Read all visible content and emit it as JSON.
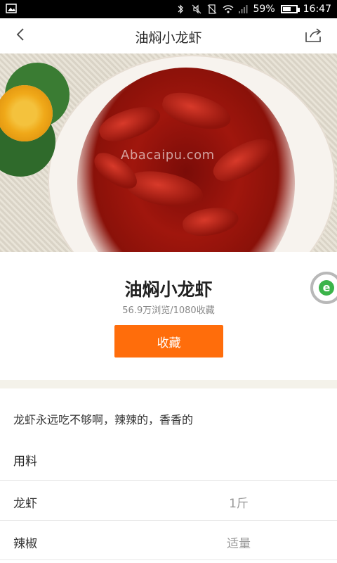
{
  "status_bar": {
    "battery_percent": "59%",
    "time": "16:47",
    "battery_level": 0.59
  },
  "header": {
    "title": "油焖小龙虾"
  },
  "hero": {
    "watermark": "Abacaipu.com"
  },
  "recipe": {
    "title": "油焖小龙虾",
    "stats": "56.9万浏览/1080收藏",
    "favorite_label": "收藏",
    "description": "龙虾永远吃不够啊，辣辣的，香香的"
  },
  "ingredients_section": {
    "title": "用料",
    "items": [
      {
        "name": "龙虾",
        "qty": "1斤"
      },
      {
        "name": "辣椒",
        "qty": "适量"
      }
    ]
  },
  "colors": {
    "accent": "#ff6d0b",
    "status_bar_bg": "#000000",
    "divider_band": "#f4f2ea"
  },
  "icons": {
    "back": "chevron-left-icon",
    "share": "share-icon",
    "image": "image-icon",
    "badge": "e-badge-icon"
  }
}
